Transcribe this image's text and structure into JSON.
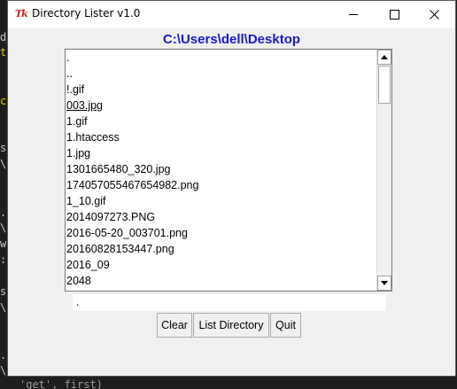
{
  "window": {
    "title": "Directory Lister v1.0",
    "app_icon_text": "Tk"
  },
  "path_label": "C:\\Users\\dell\\Desktop",
  "file_list": {
    "items": [
      ".",
      "..",
      "!.gif",
      "003.jpg",
      "1.gif",
      "1.htaccess",
      "1.jpg",
      "1301665480_320.jpg",
      "174057055467654982.png",
      "1_10.gif",
      "2014097273.PNG",
      "2016-05-20_003701.png",
      "20160828153447.png",
      "2016_09",
      "2048"
    ],
    "active_index": 3
  },
  "entry": {
    "value": "."
  },
  "buttons": {
    "clear": "Clear",
    "list_directory": "List Directory",
    "quit": "Quit"
  },
  "background_terminal": {
    "fragments": [
      "d",
      "t",
      "c",
      "s",
      "\\",
      ".",
      "\\",
      "w",
      ":",
      "s",
      "\\",
      ".",
      "\\",
      "'get', first)"
    ]
  },
  "colors": {
    "path_label": "#1a1acd",
    "window_bg": "#f0f0f0",
    "terminal_bg": "#1e1e1e",
    "tk_icon": "#cc1f1f"
  }
}
